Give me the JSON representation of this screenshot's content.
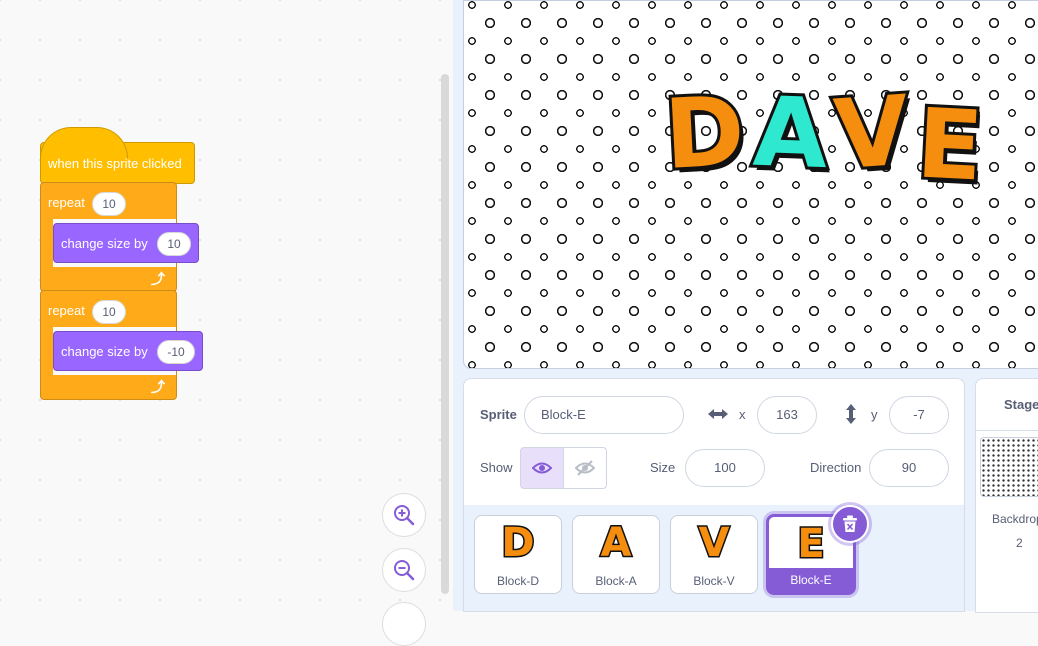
{
  "code": {
    "hat_label": "when this sprite clicked",
    "repeat1": {
      "label": "repeat",
      "count": "10",
      "inner_label": "change size by",
      "inner_value": "10"
    },
    "repeat2": {
      "label": "repeat",
      "count": "10",
      "inner_label": "change size by",
      "inner_value": "-10"
    }
  },
  "stage": {
    "title_letters": [
      "D",
      "A",
      "V",
      "E"
    ]
  },
  "sprite_info": {
    "sprite_label": "Sprite",
    "sprite_name": "Block-E",
    "x_label": "x",
    "x_value": "163",
    "y_label": "y",
    "y_value": "-7",
    "show_label": "Show",
    "size_label": "Size",
    "size_value": "100",
    "direction_label": "Direction",
    "direction_value": "90"
  },
  "sprites": [
    {
      "name": "Block-D",
      "glyph": "D"
    },
    {
      "name": "Block-A",
      "glyph": "A"
    },
    {
      "name": "Block-V",
      "glyph": "V"
    },
    {
      "name": "Block-E",
      "glyph": "E"
    }
  ],
  "stage_panel": {
    "title": "Stage",
    "backdrops_label": "Backdrops",
    "backdrops_count": "2"
  },
  "colors": {
    "accent": "#855cd6",
    "events": "#ffbf00",
    "control": "#ffab19",
    "looks": "#9966ff",
    "letter_orange": "#f58d0f",
    "letter_teal": "#2ee8d0"
  }
}
